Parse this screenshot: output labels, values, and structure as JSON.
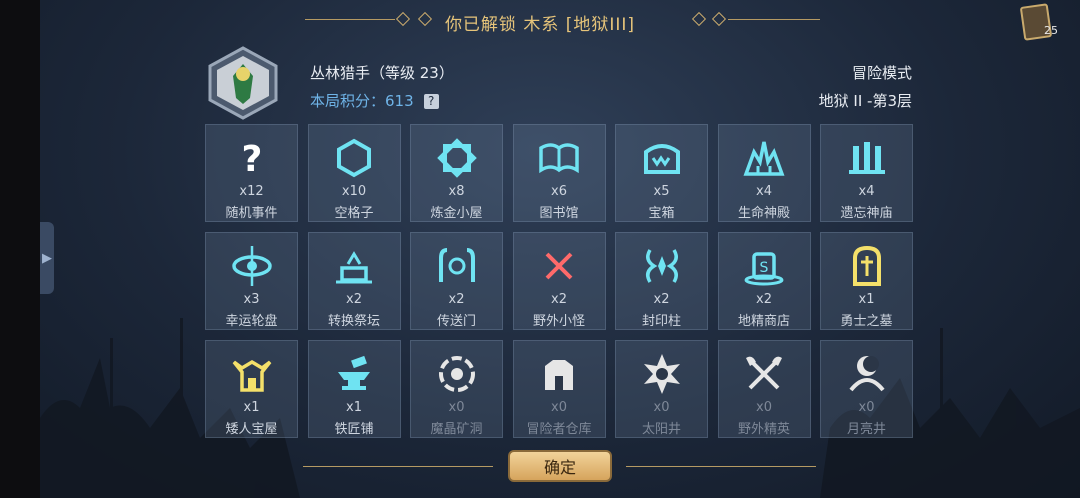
{
  "header": {
    "title": "你已解锁 木系 [地狱III]",
    "deck_count": "25"
  },
  "player": {
    "name": "丛林猎手（等级 23）",
    "score_label": "本局积分：613",
    "help": "?"
  },
  "mode": {
    "name": "冒险模式",
    "floor": "地狱 II -第3层"
  },
  "tiles": [
    {
      "count": "x12",
      "label": "随机事件",
      "icon": "question-icon"
    },
    {
      "count": "x10",
      "label": "空格子",
      "icon": "hexagon-icon"
    },
    {
      "count": "x8",
      "label": "炼金小屋",
      "icon": "alchemy-icon"
    },
    {
      "count": "x6",
      "label": "图书馆",
      "icon": "book-icon"
    },
    {
      "count": "x5",
      "label": "宝箱",
      "icon": "chest-icon"
    },
    {
      "count": "x4",
      "label": "生命神殿",
      "icon": "life-temple-icon"
    },
    {
      "count": "x4",
      "label": "遗忘神庙",
      "icon": "forgotten-temple-icon"
    },
    {
      "count": "x3",
      "label": "幸运轮盘",
      "icon": "lucky-wheel-icon"
    },
    {
      "count": "x2",
      "label": "转换祭坛",
      "icon": "altar-icon"
    },
    {
      "count": "x2",
      "label": "传送门",
      "icon": "portal-icon"
    },
    {
      "count": "x2",
      "label": "野外小怪",
      "icon": "crossed-swords-icon"
    },
    {
      "count": "x2",
      "label": "封印柱",
      "icon": "seal-pillar-icon"
    },
    {
      "count": "x2",
      "label": "地精商店",
      "icon": "goblin-shop-icon"
    },
    {
      "count": "x1",
      "label": "勇士之墓",
      "icon": "tombstone-icon"
    },
    {
      "count": "x1",
      "label": "矮人宝屋",
      "icon": "dwarf-helmet-icon"
    },
    {
      "count": "x1",
      "label": "铁匠铺",
      "icon": "anvil-icon"
    },
    {
      "count": "x0",
      "label": "魔晶矿洞",
      "icon": "crystal-mine-icon"
    },
    {
      "count": "x0",
      "label": "冒险者仓库",
      "icon": "warehouse-icon"
    },
    {
      "count": "x0",
      "label": "太阳井",
      "icon": "sun-well-icon"
    },
    {
      "count": "x0",
      "label": "野外精英",
      "icon": "crossed-axes-icon"
    },
    {
      "count": "x0",
      "label": "月亮井",
      "icon": "moon-well-icon"
    }
  ],
  "confirm_label": "确定",
  "colors": {
    "cyan": "#6fe3f2",
    "red": "#ff6a6a",
    "gold": "#f4e06a",
    "white": "#ffffff",
    "grey": "#9aa3ae"
  }
}
